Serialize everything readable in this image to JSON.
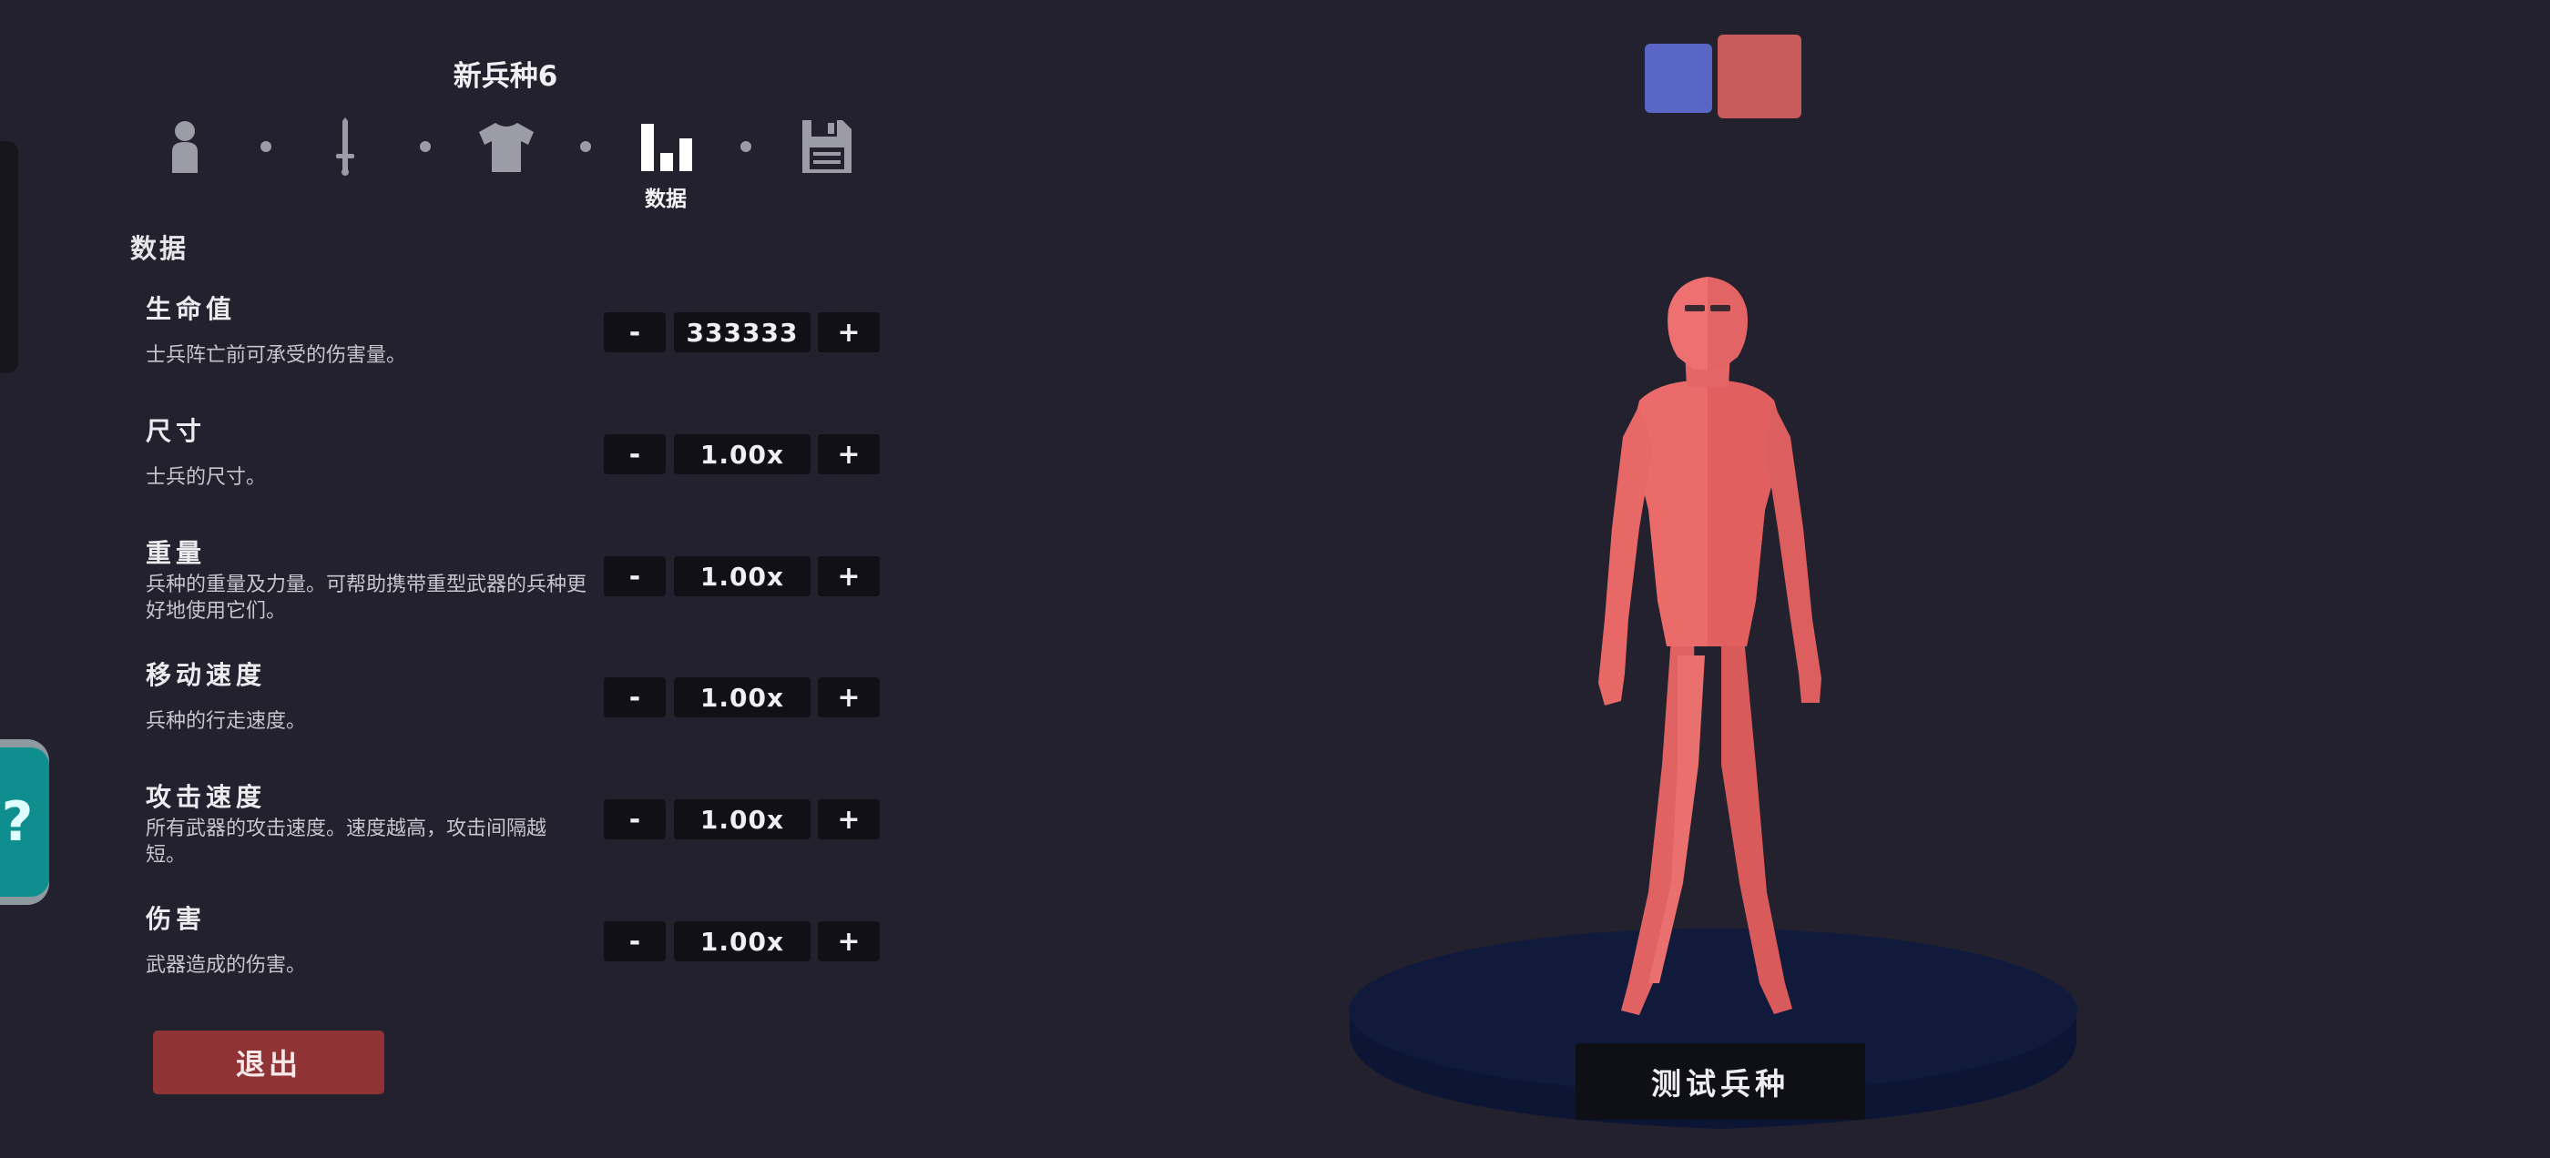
{
  "header": {
    "title": "新兵种6"
  },
  "steps": [
    {
      "icon": "person-icon",
      "active": false
    },
    {
      "icon": "sword-icon",
      "active": false
    },
    {
      "icon": "shirt-icon",
      "active": false
    },
    {
      "icon": "bar-chart-icon",
      "active": true,
      "label": "数据"
    },
    {
      "icon": "floppy-disk-icon",
      "active": false
    }
  ],
  "section": {
    "title": "数据"
  },
  "stats": [
    {
      "name": "生命值",
      "desc": "士兵阵亡前可承受的伤害量。",
      "value": "333333"
    },
    {
      "name": "尺寸",
      "desc": "士兵的尺寸。",
      "value": "1.00x"
    },
    {
      "name": "重量",
      "desc": "兵种的重量及力量。可帮助携带重型武器的兵种更好地使用它们。",
      "value": "1.00x"
    },
    {
      "name": "移动速度",
      "desc": "兵种的行走速度。",
      "value": "1.00x"
    },
    {
      "name": "攻击速度",
      "desc": "所有武器的攻击速度。速度越高，攻击间隔越短。",
      "value": "1.00x"
    },
    {
      "name": "伤害",
      "desc": "武器造成的伤害。",
      "value": "1.00x"
    }
  ],
  "controls": {
    "minus_label": "-",
    "plus_label": "+"
  },
  "footer": {
    "exit_label": "退出",
    "test_label": "测试兵种"
  },
  "teams": {
    "blue": "#5966c6",
    "red": "#c75b5b"
  },
  "colors": {
    "background": "#22212d",
    "unit_body": "#e96969",
    "platform": "#111830",
    "exit_button": "#8f3334"
  }
}
